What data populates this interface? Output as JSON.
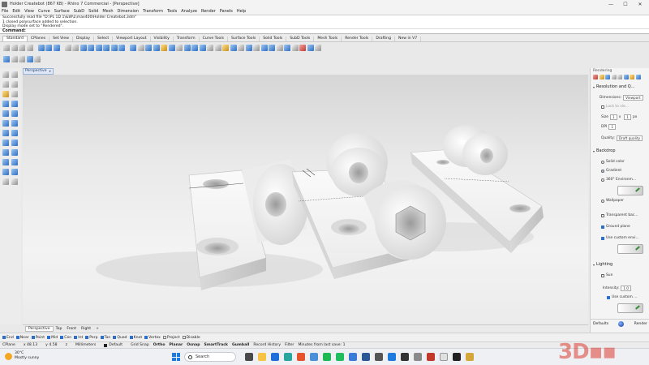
{
  "window": {
    "title": "Holder Createbot (867 KB) - Rhino 7 Commercial - [Perspective]",
    "controls": [
      "—",
      "☐",
      "✕"
    ]
  },
  "menu": [
    "File",
    "Edit",
    "View",
    "Curve",
    "Surface",
    "SubD",
    "Solid",
    "Mesh",
    "Dimension",
    "Transform",
    "Tools",
    "Analyze",
    "Render",
    "Panels",
    "Help"
  ],
  "command_history": [
    "Successfully read file \"D:\\PL 1D 1\\&W\\L\\max400\\Holder Createbot.3dm\"",
    "1 closed polysurface added to selection.",
    "Display mode set to \"Rendered\"."
  ],
  "command_prompt": "Command:",
  "toolbar_tabs": [
    "Standard",
    "CPlanes",
    "Set View",
    "Display",
    "Select",
    "Viewport Layout",
    "Visibility",
    "Transform",
    "Curve Tools",
    "Surface Tools",
    "Solid Tools",
    "SubD Tools",
    "Mesh Tools",
    "Render Tools",
    "Drafting",
    "New in V7"
  ],
  "active_toolbar_tab": "Standard",
  "viewport": {
    "label": "Perspective",
    "dropdown_glyph": "▾"
  },
  "view_tabs": [
    "Perspective",
    "Top",
    "Front",
    "Right",
    "+"
  ],
  "osnaps": [
    {
      "label": "End",
      "on": true
    },
    {
      "label": "Near",
      "on": true
    },
    {
      "label": "Point",
      "on": true
    },
    {
      "label": "Mid",
      "on": true
    },
    {
      "label": "Cen",
      "on": true
    },
    {
      "label": "Int",
      "on": true
    },
    {
      "label": "Perp",
      "on": true
    },
    {
      "label": "Tan",
      "on": true
    },
    {
      "label": "Quad",
      "on": true
    },
    {
      "label": "Knot",
      "on": true
    },
    {
      "label": "Vertex",
      "on": true
    },
    {
      "label": "Project",
      "on": false
    },
    {
      "label": "Disable",
      "on": false
    }
  ],
  "status": {
    "cplane": "CPlane",
    "x": "x 48.13",
    "y": "y 4.58",
    "z": "z",
    "units": "Millimeters",
    "layer": "Default",
    "toggles": [
      "Grid Snap",
      "Ortho",
      "Planar",
      "Osnap",
      "SmartTrack",
      "Gumball",
      "Record History",
      "Filter"
    ],
    "bold_toggles": [
      "Ortho",
      "Planar",
      "Osnap",
      "SmartTrack",
      "Gumball"
    ],
    "save_info": "Minutes from last save: 1"
  },
  "taskbar": {
    "temperature": "30°C",
    "weather": "Mostly sunny",
    "search_placeholder": "Search"
  },
  "right_panel": {
    "header": "Rendering",
    "section_resolution": "Resolution and Q...",
    "dimensions_label": "Dimensions:",
    "dimensions_value": "Viewport",
    "lock_label": "Lock to vie...",
    "size_label": "Size",
    "size_w": "1",
    "size_x": "x",
    "size_h": "1",
    "size_unit": "px",
    "dpi_label": "DPI",
    "dpi_value": "1",
    "quality_label": "Quality:",
    "quality_value": "Draft quality",
    "section_backdrop": "Backdrop",
    "solid_color": "Solid color",
    "gradient": "Gradient",
    "env360": "360° Environm...",
    "wallpaper": "Wallpaper",
    "transparent": "Transparent bac...",
    "ground_plane": "Ground plane",
    "custom_env": "Use custom envi...",
    "section_lighting": "Lighting",
    "sun": "Sun",
    "intensity_label": "Intensity:",
    "intensity_value": "1.0",
    "use_custom": "Use custom ...",
    "defaults": "Defaults",
    "render": "Render"
  },
  "watermark": "3DP"
}
